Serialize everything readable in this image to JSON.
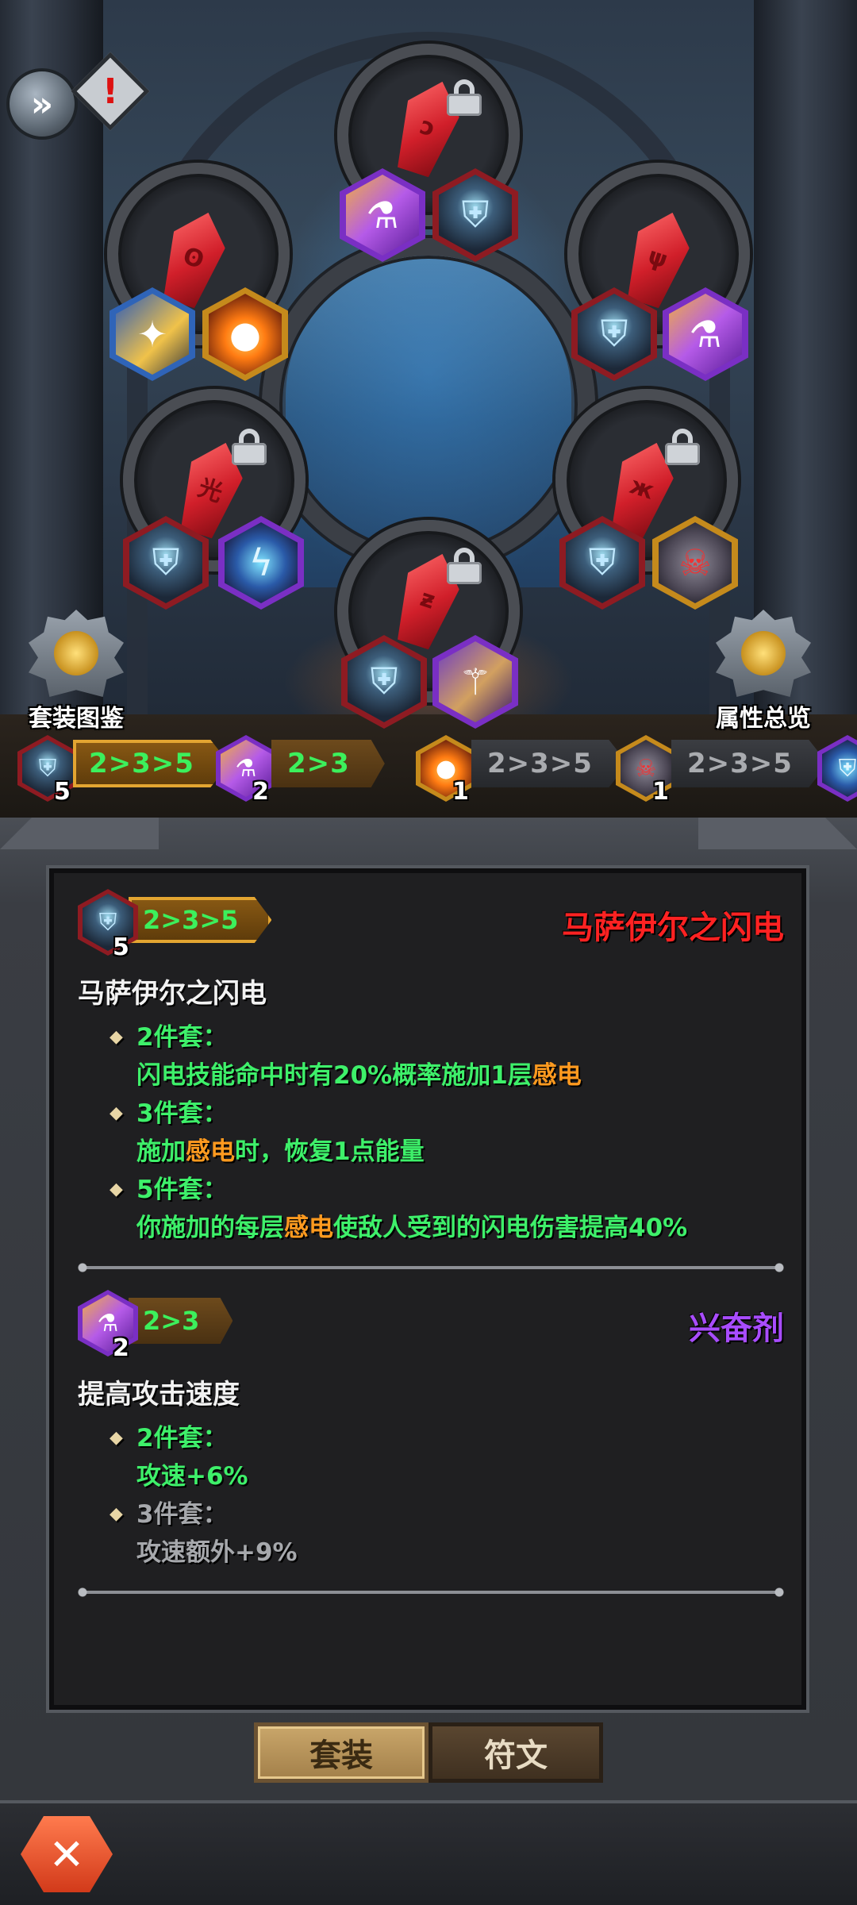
{
  "top_controls": {
    "expand_icon": "double-chevron-right-icon",
    "alert_icon": "exclamation-icon",
    "expand_glyph": "»",
    "alert_glyph": "!"
  },
  "corner_buttons": {
    "left_label": "套装图鉴",
    "right_label": "属性总览"
  },
  "slots": [
    {
      "id": "top",
      "gem_mark": "ↄ",
      "locked": true,
      "icons": [
        "potion",
        "helm"
      ]
    },
    {
      "id": "upper-left",
      "gem_mark": "ʘ",
      "locked": false,
      "icons": [
        "claw",
        "fire"
      ]
    },
    {
      "id": "upper-right",
      "gem_mark": "ψ",
      "locked": false,
      "icons": [
        "helm",
        "potion"
      ]
    },
    {
      "id": "lower-left",
      "gem_mark": "光",
      "locked": true,
      "icons": [
        "helm",
        "bolt"
      ]
    },
    {
      "id": "lower-right",
      "gem_mark": "ж",
      "locked": true,
      "icons": [
        "helm",
        "skull"
      ]
    },
    {
      "id": "bottom",
      "gem_mark": "ƶ",
      "locked": true,
      "icons": [
        "helm",
        "lance"
      ]
    }
  ],
  "set_strip": [
    {
      "icon": "helm",
      "count": "5",
      "tiers": "2>3>5",
      "state": "active"
    },
    {
      "icon": "potion",
      "count": "2",
      "tiers": "2>3",
      "state": "active-brown"
    },
    {
      "icon": "fire",
      "count": "1",
      "tiers": "2>3>5",
      "state": "inactive"
    },
    {
      "icon": "skull",
      "count": "1",
      "tiers": "2>3>5",
      "state": "inactive"
    }
  ],
  "sets": [
    {
      "icon": "helm",
      "count": "5",
      "tiers": "2>3>5",
      "name": "马萨伊尔之闪电",
      "description": "马萨伊尔之闪电",
      "bonuses": [
        {
          "pieces": "2件套：",
          "active": true,
          "effect_pre": "闪电技能命中时有20%概率施加1层",
          "keyword": "感电",
          "effect_post": ""
        },
        {
          "pieces": "3件套：",
          "active": true,
          "effect_pre": "施加",
          "keyword": "感电",
          "effect_post": "时，恢复1点能量"
        },
        {
          "pieces": "5件套：",
          "active": true,
          "effect_pre": "你施加的每层",
          "keyword": "感电",
          "effect_post": "使敌人受到的闪电伤害提高40%"
        }
      ]
    },
    {
      "icon": "potion",
      "count": "2",
      "tiers": "2>3",
      "name": "兴奋剂",
      "description": "提高攻击速度",
      "bonuses": [
        {
          "pieces": "2件套：",
          "active": true,
          "effect_pre": "攻速+6%",
          "keyword": "",
          "effect_post": ""
        },
        {
          "pieces": "3件套：",
          "active": false,
          "effect_pre": "攻速额外+9%",
          "keyword": "",
          "effect_post": ""
        }
      ]
    }
  ],
  "tabs": [
    {
      "label": "套装",
      "selected": true
    },
    {
      "label": "符文",
      "selected": false
    }
  ],
  "close_button": {
    "icon": "close-x-icon",
    "glyph": "✕"
  },
  "colors": {
    "active_text": "#3ef06a",
    "inactive_text": "#a6a8ac",
    "keyword": "#ff9a1f",
    "set1_title": "#ff2222",
    "set2_title": "#a84cff"
  }
}
